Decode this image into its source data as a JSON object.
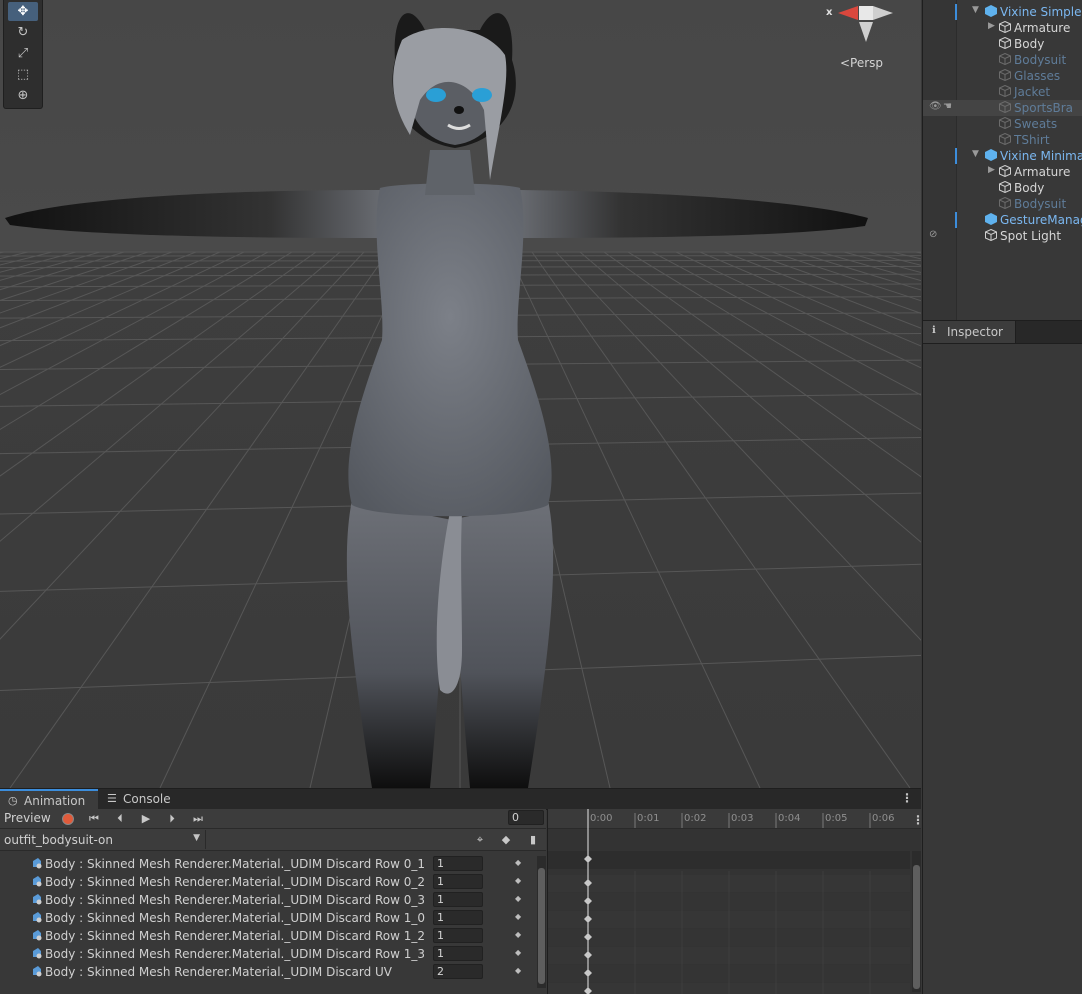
{
  "scene": {
    "persp_label": "<Persp",
    "axis_x_label": "x",
    "tools": [
      "move-tool-icon",
      "rotate-tool-icon",
      "scale-tool-icon",
      "rect-tool-icon",
      "transform-tool-icon"
    ]
  },
  "hierarchy": {
    "items": [
      {
        "label": "Vixine Simple",
        "kind": "prefab",
        "expanded": true
      },
      {
        "label": "Armature",
        "kind": "child",
        "collapsed": true
      },
      {
        "label": "Body",
        "kind": "child"
      },
      {
        "label": "Bodysuit",
        "kind": "child-dim"
      },
      {
        "label": "Glasses",
        "kind": "child-dim"
      },
      {
        "label": "Jacket",
        "kind": "child-dim"
      },
      {
        "label": "SportsBra",
        "kind": "child-dim"
      },
      {
        "label": "Sweats",
        "kind": "child-dim"
      },
      {
        "label": "TShirt",
        "kind": "child-dim"
      },
      {
        "label": "Vixine Minimal",
        "kind": "prefab",
        "expanded": true
      },
      {
        "label": "Armature",
        "kind": "child",
        "collapsed": true
      },
      {
        "label": "Body",
        "kind": "child"
      },
      {
        "label": "Bodysuit",
        "kind": "child-dim"
      },
      {
        "label": "GestureManager",
        "kind": "prefab"
      },
      {
        "label": "Spot Light",
        "kind": "object"
      }
    ]
  },
  "inspector": {
    "tab_label": "Inspector"
  },
  "animation": {
    "tabs": [
      {
        "label": "Animation"
      },
      {
        "label": "Console"
      }
    ],
    "preview_label": "Preview",
    "frame_value": "0",
    "clip_name": "outfit_bodysuit-on",
    "properties": [
      {
        "name": "Body : Skinned Mesh Renderer.Material._UDIM Discard Row 0_1",
        "value": "1"
      },
      {
        "name": "Body : Skinned Mesh Renderer.Material._UDIM Discard Row 0_2",
        "value": "1"
      },
      {
        "name": "Body : Skinned Mesh Renderer.Material._UDIM Discard Row 0_3",
        "value": "1"
      },
      {
        "name": "Body : Skinned Mesh Renderer.Material._UDIM Discard Row 1_0",
        "value": "1"
      },
      {
        "name": "Body : Skinned Mesh Renderer.Material._UDIM Discard Row 1_2",
        "value": "1"
      },
      {
        "name": "Body : Skinned Mesh Renderer.Material._UDIM Discard Row 1_3",
        "value": "1"
      },
      {
        "name": "Body : Skinned Mesh Renderer.Material._UDIM Discard UV",
        "value": "2"
      }
    ],
    "timeline_ticks": [
      "0:00",
      "0:01",
      "0:02",
      "0:03",
      "0:04",
      "0:05",
      "0:06"
    ]
  },
  "colors": {
    "accent": "#3c8ddb",
    "prefab_text": "#7bb7f0",
    "record": "#e05b3b"
  }
}
